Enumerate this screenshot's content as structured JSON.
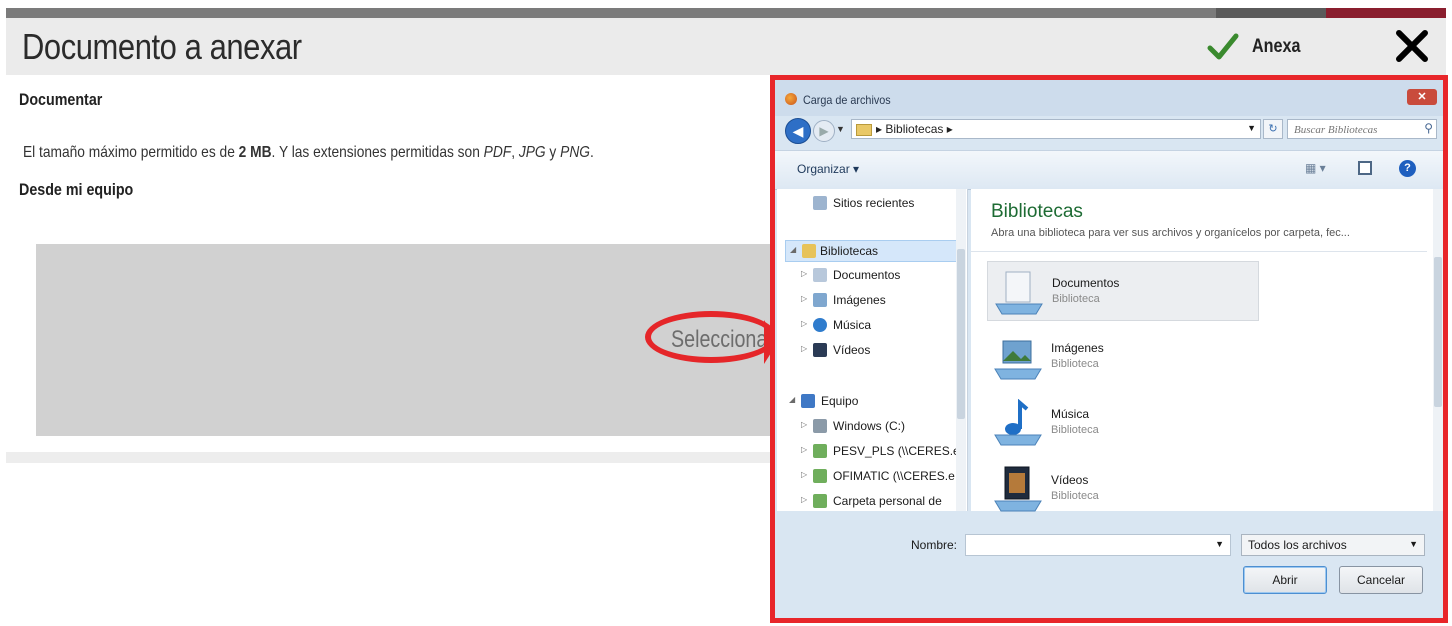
{
  "header": {
    "title": "Documento a anexar",
    "attach_label": "Anexa",
    "accent": "#3a8a2e"
  },
  "form": {
    "section_title": "Documentar",
    "info_prefix": "El tamaño máximo permitido es de ",
    "max_size": "2 MB",
    "info_middle": ". Y las extensiones permitidas son ",
    "ext_pdf": "PDF",
    "sep1": ", ",
    "ext_jpg": "JPG",
    "sep2": " y ",
    "ext_png": "PNG",
    "info_end": ".",
    "source_title": "Desde mi equipo",
    "dropzone_label": "Seleccionar"
  },
  "highlight_color": "#e52629",
  "dialog": {
    "title": "Carga de archivos",
    "breadcrumb": "▸ Bibliotecas ▸",
    "search_placeholder": "Buscar Bibliotecas",
    "organize": "Organizar ▾",
    "nav": {
      "recent": "Sitios recientes",
      "libraries": "Bibliotecas",
      "documents": "Documentos",
      "images": "Imágenes",
      "music": "Música",
      "videos": "Vídeos",
      "computer": "Equipo",
      "drive_c": "Windows (C:)",
      "share1": "PESV_PLS (\\\\CERES.ec",
      "share2": "OFIMATIC (\\\\CERES.e",
      "share3": "Carpeta personal de"
    },
    "content_title": "Bibliotecas",
    "content_desc": "Abra una biblioteca para ver sus archivos y organícelos por carpeta, fec...",
    "libraries": [
      {
        "name": "Documentos",
        "type": "Biblioteca"
      },
      {
        "name": "Imágenes",
        "type": "Biblioteca"
      },
      {
        "name": "Música",
        "type": "Biblioteca"
      },
      {
        "name": "Vídeos",
        "type": "Biblioteca"
      }
    ],
    "filename_label": "Nombre:",
    "filename_value": "",
    "filter": "Todos los archivos",
    "open": "Abrir",
    "cancel": "Cancelar"
  }
}
